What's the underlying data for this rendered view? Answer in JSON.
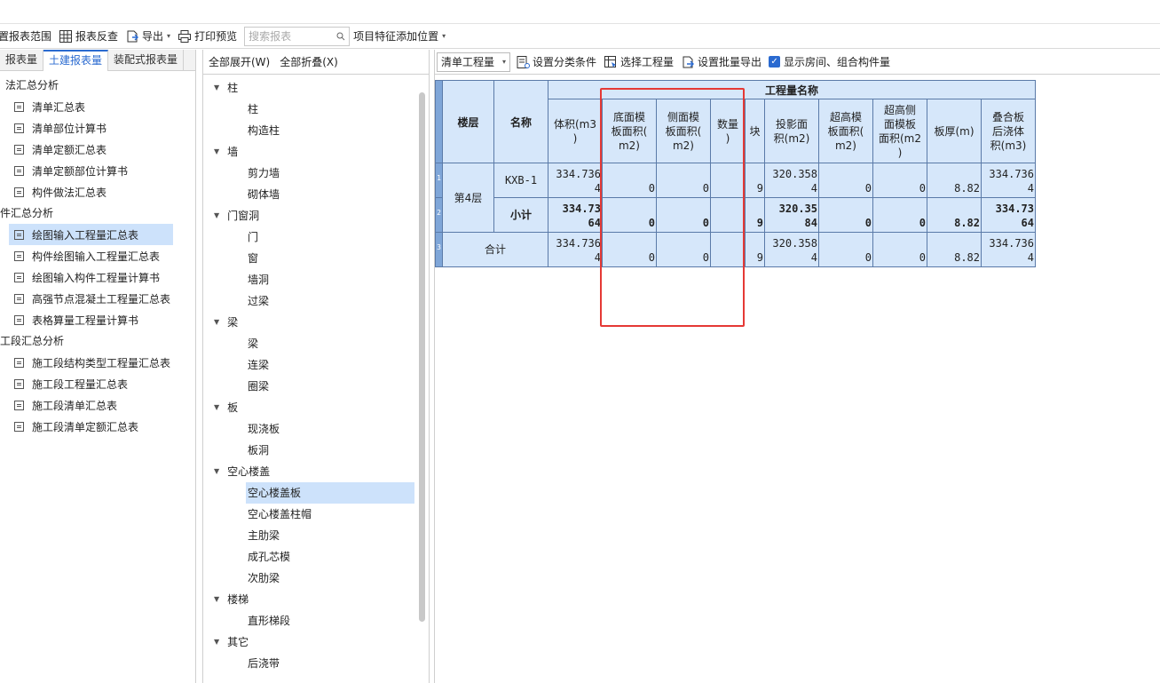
{
  "toolbar": {
    "report_range": "置报表范围",
    "report_check": "报表反查",
    "export": "导出",
    "print_preview": "打印预览",
    "search_placeholder": "搜索报表",
    "feature_position": "项目特征添加位置"
  },
  "left": {
    "tabs": [
      "报表量",
      "土建报表量",
      "装配式报表量"
    ],
    "groups": [
      {
        "title": "法汇总分析",
        "items": [
          "清单汇总表",
          "清单部位计算书",
          "清单定额汇总表",
          "清单定额部位计算书",
          "构件做法汇总表"
        ]
      },
      {
        "title": "件汇总分析",
        "items": [
          "绘图输入工程量汇总表",
          "构件绘图输入工程量汇总表",
          "绘图输入构件工程量计算书",
          "高强节点混凝土工程量汇总表",
          "表格算量工程量计算书"
        ]
      },
      {
        "title": "工段汇总分析",
        "items": [
          "施工段结构类型工程量汇总表",
          "施工段工程量汇总表",
          "施工段清单汇总表",
          "施工段清单定额汇总表"
        ]
      }
    ],
    "selected": "绘图输入工程量汇总表"
  },
  "middle": {
    "expand_all": "全部展开(W)",
    "collapse_all": "全部折叠(X)",
    "tree": [
      {
        "group": "柱",
        "items": [
          "柱",
          "构造柱"
        ]
      },
      {
        "group": "墙",
        "items": [
          "剪力墙",
          "砌体墙"
        ]
      },
      {
        "group": "门窗洞",
        "items": [
          "门",
          "窗",
          "墙洞",
          "过梁"
        ]
      },
      {
        "group": "梁",
        "items": [
          "梁",
          "连梁",
          "圈梁"
        ]
      },
      {
        "group": "板",
        "items": [
          "现浇板",
          "板洞"
        ]
      },
      {
        "group": "空心楼盖",
        "items": [
          "空心楼盖板",
          "空心楼盖柱帽",
          "主肋梁",
          "成孔芯模",
          "次肋梁"
        ]
      },
      {
        "group": "楼梯",
        "items": [
          "直形梯段"
        ]
      },
      {
        "group": "其它",
        "items": [
          "后浇带"
        ]
      }
    ],
    "selected": "空心楼盖板"
  },
  "right": {
    "select_value": "清单工程量",
    "set_category": "设置分类条件",
    "select_quantity": "选择工程量",
    "batch_export": "设置批量导出",
    "show_rooms_label": "显示房间、组合构件量",
    "show_rooms_checked": true
  },
  "table": {
    "group_header": "工程量名称",
    "col_floor": "楼层",
    "col_name": "名称",
    "columns": [
      [
        "体积(m3",
        ")"
      ],
      [
        "底面模",
        "板面积(",
        "m2)"
      ],
      [
        "侧面模",
        "板面积(",
        "m2)"
      ],
      [
        "数量",
        ")"
      ],
      [
        "块"
      ],
      [
        "投影面",
        "积(m2)"
      ],
      [
        "超高模",
        "板面积(",
        "m2)"
      ],
      [
        "超高侧",
        "面模板",
        "面积(m2",
        ")"
      ],
      [
        "板厚(m)"
      ],
      [
        "叠合板",
        "后浇体",
        "积(m3)"
      ]
    ],
    "row_numbers": [
      "1",
      "2",
      "3"
    ],
    "floor": "第4层",
    "rows": [
      {
        "name": "KXB-1",
        "cells": [
          [
            "334.736",
            "4"
          ],
          [
            "0"
          ],
          [
            "0"
          ],
          [
            ""
          ],
          [
            "9"
          ],
          [
            "320.358",
            "4"
          ],
          [
            "0"
          ],
          [
            "0"
          ],
          [
            "8.82"
          ],
          [
            "334.736",
            "4"
          ]
        ]
      },
      {
        "name": "小计",
        "cells": [
          [
            "334.73",
            "64"
          ],
          [
            "0"
          ],
          [
            "0"
          ],
          [
            ""
          ],
          [
            "9"
          ],
          [
            "320.35",
            "84"
          ],
          [
            "0"
          ],
          [
            "0"
          ],
          [
            "8.82"
          ],
          [
            "334.73",
            "64"
          ]
        ]
      }
    ],
    "total_label": "合计",
    "total_cells": [
      [
        "334.736",
        "4"
      ],
      [
        "0"
      ],
      [
        "0"
      ],
      [
        ""
      ],
      [
        "9"
      ],
      [
        "320.358",
        "4"
      ],
      [
        "0"
      ],
      [
        "0"
      ],
      [
        "8.82"
      ],
      [
        "334.736",
        "4"
      ]
    ]
  }
}
